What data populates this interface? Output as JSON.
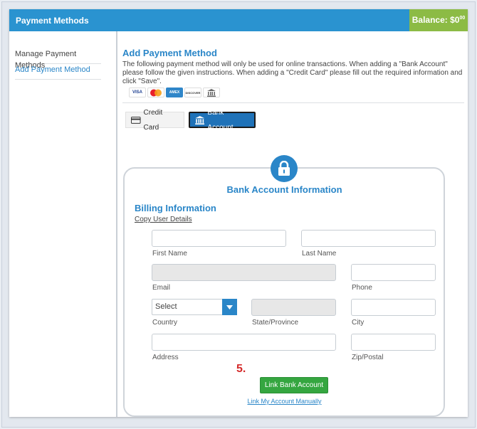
{
  "header": {
    "title": "Payment Methods",
    "balance_label": "Balance: $0",
    "balance_cents": "00"
  },
  "sidebar": {
    "items": [
      {
        "label": "Manage Payment Methods"
      },
      {
        "label": "Add Payment Method"
      }
    ]
  },
  "main": {
    "title": "Add Payment Method",
    "description": "The following payment method will only be used for online transactions. When adding a \"Bank Account\" please follow the given instructions. When adding a \"Credit Card\" please fill out the required information and click \"Save\".",
    "card_logos": [
      {
        "name": "VISA"
      },
      {
        "name": "mastercard"
      },
      {
        "name": "AMEX"
      },
      {
        "name": "DISCOVER"
      }
    ],
    "tabs": [
      {
        "label": "Credit Card"
      },
      {
        "label": "Bank Account"
      }
    ]
  },
  "form": {
    "title": "Bank Account Information",
    "billing_title": "Billing Information",
    "copy_link": "Copy User Details",
    "labels": {
      "first_name": "First Name",
      "last_name": "Last Name",
      "email": "Email",
      "phone": "Phone",
      "country": "Country",
      "state": "State/Province",
      "city": "City",
      "address": "Address",
      "zip": "Zip/Postal"
    },
    "country_value": "Select",
    "step": "5.",
    "submit_label": "Link Bank Account",
    "manual_link": "Link My Account Manually"
  },
  "colors": {
    "header": "#2a93d0",
    "balance": "#8cbb45",
    "accent": "#2a86c8",
    "submit": "#35a640",
    "step": "#d42a2a"
  }
}
